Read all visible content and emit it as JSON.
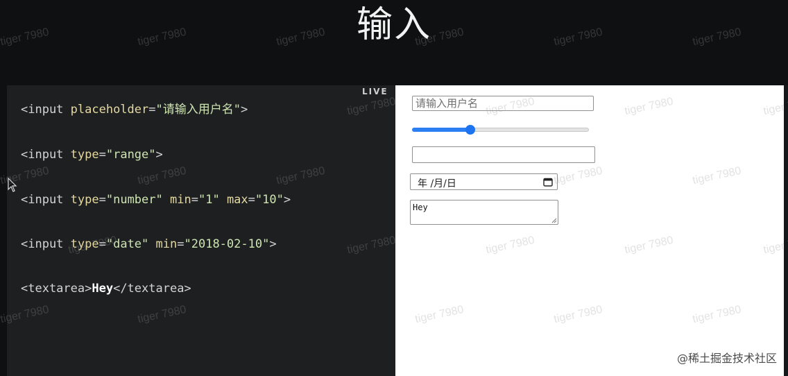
{
  "title": "输入",
  "live_label": "LIVE",
  "code": {
    "line1": {
      "open": "<input ",
      "attr": "placeholder",
      "eq": "=",
      "val": "\"请输入用户名\"",
      "close": ">"
    },
    "line2": {
      "open": "<input ",
      "attr": "type",
      "eq": "=",
      "val": "\"range\"",
      "close": ">"
    },
    "line3": {
      "open": "<input ",
      "attr1": "type",
      "eq": "=",
      "val1": "\"number\"",
      "attr2": "min",
      "val2": "\"1\"",
      "attr3": "max",
      "val3": "\"10\"",
      "close": ">"
    },
    "line4": {
      "open": "<input ",
      "attr1": "type",
      "eq": "=",
      "val1": "\"date\"",
      "attr2": "min",
      "val2": "\"2018-02-10\"",
      "close": ">"
    },
    "line5": {
      "open": "<textarea>",
      "text": "Hey",
      "close": "</textarea>"
    }
  },
  "preview": {
    "text_input_placeholder": "请输入用户名",
    "range": {
      "min": 0,
      "max": 100,
      "value": 33
    },
    "date_display": "年 /月/日",
    "textarea_value": "Hey"
  },
  "watermark": "tiger 7980",
  "credit": "@稀土掘金技术社区",
  "colors": {
    "background": "#0f1011",
    "code_bg": "#1d1f21",
    "range_blue": "#1e74f0"
  }
}
